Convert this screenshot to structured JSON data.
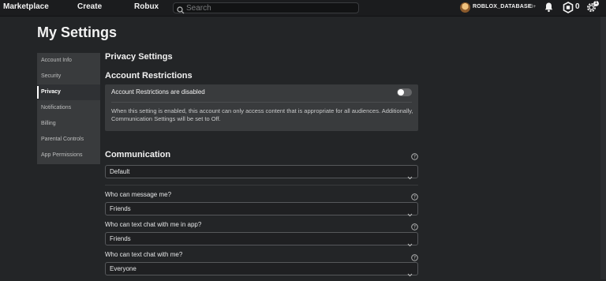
{
  "topbar": {
    "nav": [
      "Marketplace",
      "Create",
      "Robux"
    ],
    "search_placeholder": "Search",
    "username": "ROBLOX_DATABASE",
    "age_tag": "13+",
    "robux_count": "0",
    "notification_badge": "1",
    "icons": [
      "search-icon",
      "bell-icon",
      "robux-icon",
      "gear-icon"
    ]
  },
  "page": {
    "title": "My Settings"
  },
  "sidebar": {
    "items": [
      {
        "label": "Account Info"
      },
      {
        "label": "Security"
      },
      {
        "label": "Privacy"
      },
      {
        "label": "Notifications"
      },
      {
        "label": "Billing"
      },
      {
        "label": "Parental Controls"
      },
      {
        "label": "App Permissions"
      }
    ],
    "active": "Privacy"
  },
  "privacy": {
    "heading": "Privacy Settings",
    "restrictions_heading": "Account Restrictions",
    "restrictions_toggle_label": "Account Restrictions are disabled",
    "restrictions_enabled": false,
    "restrictions_description": "When this setting is enabled, this account can only access content that is appropriate for all audiences. Additionally, Communication Settings will be set to Off.",
    "communication_heading": "Communication",
    "communication_value": "Default",
    "questions": [
      {
        "label": "Who can message me?",
        "value": "Friends"
      },
      {
        "label": "Who can text chat with me in app?",
        "value": "Friends"
      },
      {
        "label": "Who can text chat with me?",
        "value": "Everyone"
      }
    ]
  },
  "colors": {
    "background": "#232527",
    "panel": "#393b3d",
    "topbar": "#1b1c1e",
    "text": "#e6e7e8"
  }
}
